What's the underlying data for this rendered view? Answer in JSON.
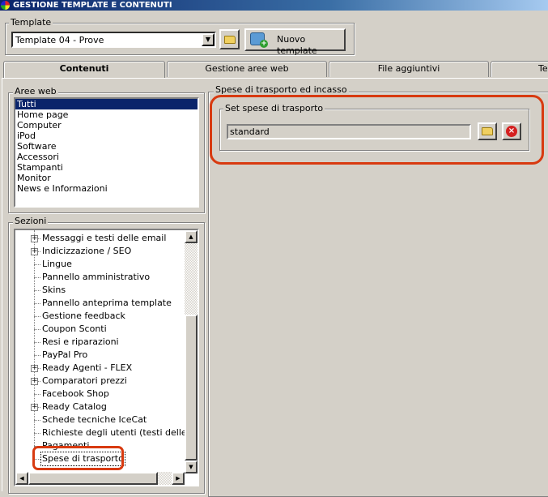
{
  "window": {
    "title": "GESTIONE TEMPLATE E CONTENUTI"
  },
  "template": {
    "group_label": "Template",
    "selected": "Template 04 - Prove",
    "new_button": "Nuovo template"
  },
  "tabs": [
    {
      "label": "Contenuti",
      "active": true
    },
    {
      "label": "Gestione aree web",
      "active": false
    },
    {
      "label": "File aggiuntivi",
      "active": false
    },
    {
      "label": "Ter",
      "active": false
    }
  ],
  "aree_web": {
    "label": "Aree web",
    "items": [
      "Tutti",
      "Home page",
      "Computer",
      "iPod",
      "Software",
      "Accessori",
      "Stampanti",
      "Monitor",
      "News e Informazioni"
    ],
    "selected_index": 0
  },
  "sezioni": {
    "label": "Sezioni",
    "items": [
      {
        "label": "Messaggi e testi delle email",
        "expandable": true
      },
      {
        "label": "Indicizzazione / SEO",
        "expandable": true
      },
      {
        "label": "Lingue",
        "expandable": false
      },
      {
        "label": "Pannello amministrativo",
        "expandable": false
      },
      {
        "label": "Skins",
        "expandable": false
      },
      {
        "label": "Pannello anteprima template",
        "expandable": false
      },
      {
        "label": "Gestione feedback",
        "expandable": false
      },
      {
        "label": "Coupon Sconti",
        "expandable": false
      },
      {
        "label": "Resi e riparazioni",
        "expandable": false
      },
      {
        "label": "PayPal Pro",
        "expandable": false
      },
      {
        "label": "Ready Agenti - FLEX",
        "expandable": true
      },
      {
        "label": "Comparatori prezzi",
        "expandable": true
      },
      {
        "label": "Facebook Shop",
        "expandable": false
      },
      {
        "label": "Ready Catalog",
        "expandable": true
      },
      {
        "label": "Schede tecniche IceCat",
        "expandable": false
      },
      {
        "label": "Richieste degli utenti (testi delle email",
        "expandable": false
      },
      {
        "label": "Pagamenti",
        "expandable": false
      },
      {
        "label": "Spese di trasporto",
        "expandable": false,
        "selected": true
      }
    ]
  },
  "content": {
    "group_label": "Spese di trasporto ed incasso",
    "set_label": "Set spese di trasporto",
    "set_value": "standard"
  },
  "colors": {
    "highlight": "#d83a10",
    "selection": "#0a246a"
  }
}
